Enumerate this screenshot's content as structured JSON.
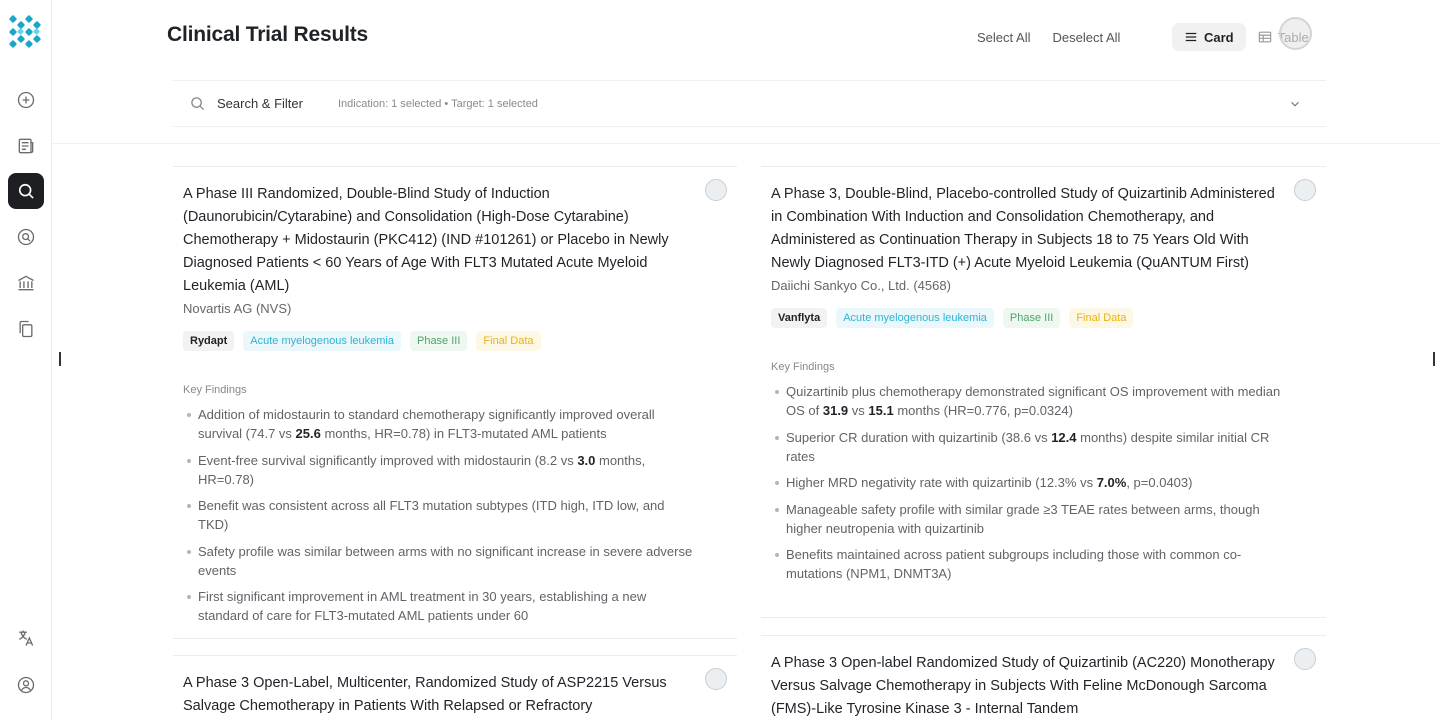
{
  "header": {
    "title": "Clinical Trial Results",
    "select_all": "Select All",
    "deselect_all": "Deselect All",
    "view_card": "Card",
    "view_table": "Table"
  },
  "search": {
    "label": "Search & Filter",
    "filter_summary": "Indication: 1 selected • Target: 1 selected"
  },
  "sidebar": {
    "items": [
      {
        "icon": "plus-circle-icon"
      },
      {
        "icon": "news-icon"
      },
      {
        "icon": "search-icon",
        "active": true
      },
      {
        "icon": "target-search-icon"
      },
      {
        "icon": "bank-icon"
      },
      {
        "icon": "copy-icon"
      },
      {
        "icon": "translate-icon"
      },
      {
        "icon": "user-icon"
      }
    ]
  },
  "key_findings_label": "Key Findings",
  "cards": [
    {
      "title": "A Phase III Randomized, Double-Blind Study of Induction (Daunorubicin/Cytarabine) and Consolidation (High-Dose Cytarabine) Chemotherapy + Midostaurin (PKC412) (IND #101261) or Placebo in Newly Diagnosed Patients < 60 Years of Age With FLT3 Mutated Acute Myeloid Leukemia (AML)",
      "company": "Novartis AG (NVS)",
      "drug": "Rydapt",
      "indication": "Acute myelogenous leukemia",
      "phase": "Phase III",
      "status": "Final Data",
      "findings": [
        {
          "pre": "Addition of midostaurin to standard chemotherapy significantly improved overall survival (74.7 vs ",
          "bold": "25.6",
          "post": " months, HR=0.78) in FLT3-mutated AML patients"
        },
        {
          "pre": "Event-free survival significantly improved with midostaurin (8.2 vs ",
          "bold": "3.0",
          "post": " months, HR=0.78)"
        },
        {
          "pre": "Benefit was consistent across all FLT3 mutation subtypes (ITD high, ITD low, and TKD)",
          "bold": "",
          "post": ""
        },
        {
          "pre": "Safety profile was similar between arms with no significant increase in severe adverse events",
          "bold": "",
          "post": ""
        },
        {
          "pre": "First significant improvement in AML treatment in 30 years, establishing a new standard of care for FLT3-mutated AML patients under 60",
          "bold": "",
          "post": ""
        }
      ]
    },
    {
      "title": "A Phase 3, Double-Blind, Placebo-controlled Study of Quizartinib Administered in Combination With Induction and Consolidation Chemotherapy, and Administered as Continuation Therapy in Subjects 18 to 75 Years Old With Newly Diagnosed FLT3-ITD (+) Acute Myeloid Leukemia (QuANTUM First)",
      "company": "Daiichi Sankyo Co., Ltd. (4568)",
      "drug": "Vanflyta",
      "indication": "Acute myelogenous leukemia",
      "phase": "Phase III",
      "status": "Final Data",
      "findings": [
        {
          "pre": "Quizartinib plus chemotherapy demonstrated significant OS improvement with median OS of ",
          "bold": "31.9",
          "mid": " vs ",
          "bold2": "15.1",
          "post": " months (HR=0.776, p=0.0324)"
        },
        {
          "pre": "Superior CR duration with quizartinib (38.6 vs ",
          "bold": "12.4",
          "post": " months) despite similar initial CR rates"
        },
        {
          "pre": "Higher MRD negativity rate with quizartinib (12.3% vs ",
          "bold": "7.0%",
          "post": ", p=0.0403)"
        },
        {
          "pre": "Manageable safety profile with similar grade ≥3 TEAE rates between arms, though higher neutropenia with quizartinib",
          "bold": "",
          "post": ""
        },
        {
          "pre": "Benefits maintained across patient subgroups including those with common co-mutations (NPM1, DNMT3A)",
          "bold": "",
          "post": ""
        }
      ]
    },
    {
      "title": "A Phase 3 Open-Label, Multicenter, Randomized Study of ASP2215 Versus Salvage Chemotherapy in Patients With Relapsed or Refractory"
    },
    {
      "title": "A Phase 3 Open-label Randomized Study of Quizartinib (AC220) Monotherapy Versus Salvage Chemotherapy in Subjects With Feline McDonough Sarcoma (FMS)-Like Tyrosine Kinase 3 - Internal Tandem"
    }
  ]
}
